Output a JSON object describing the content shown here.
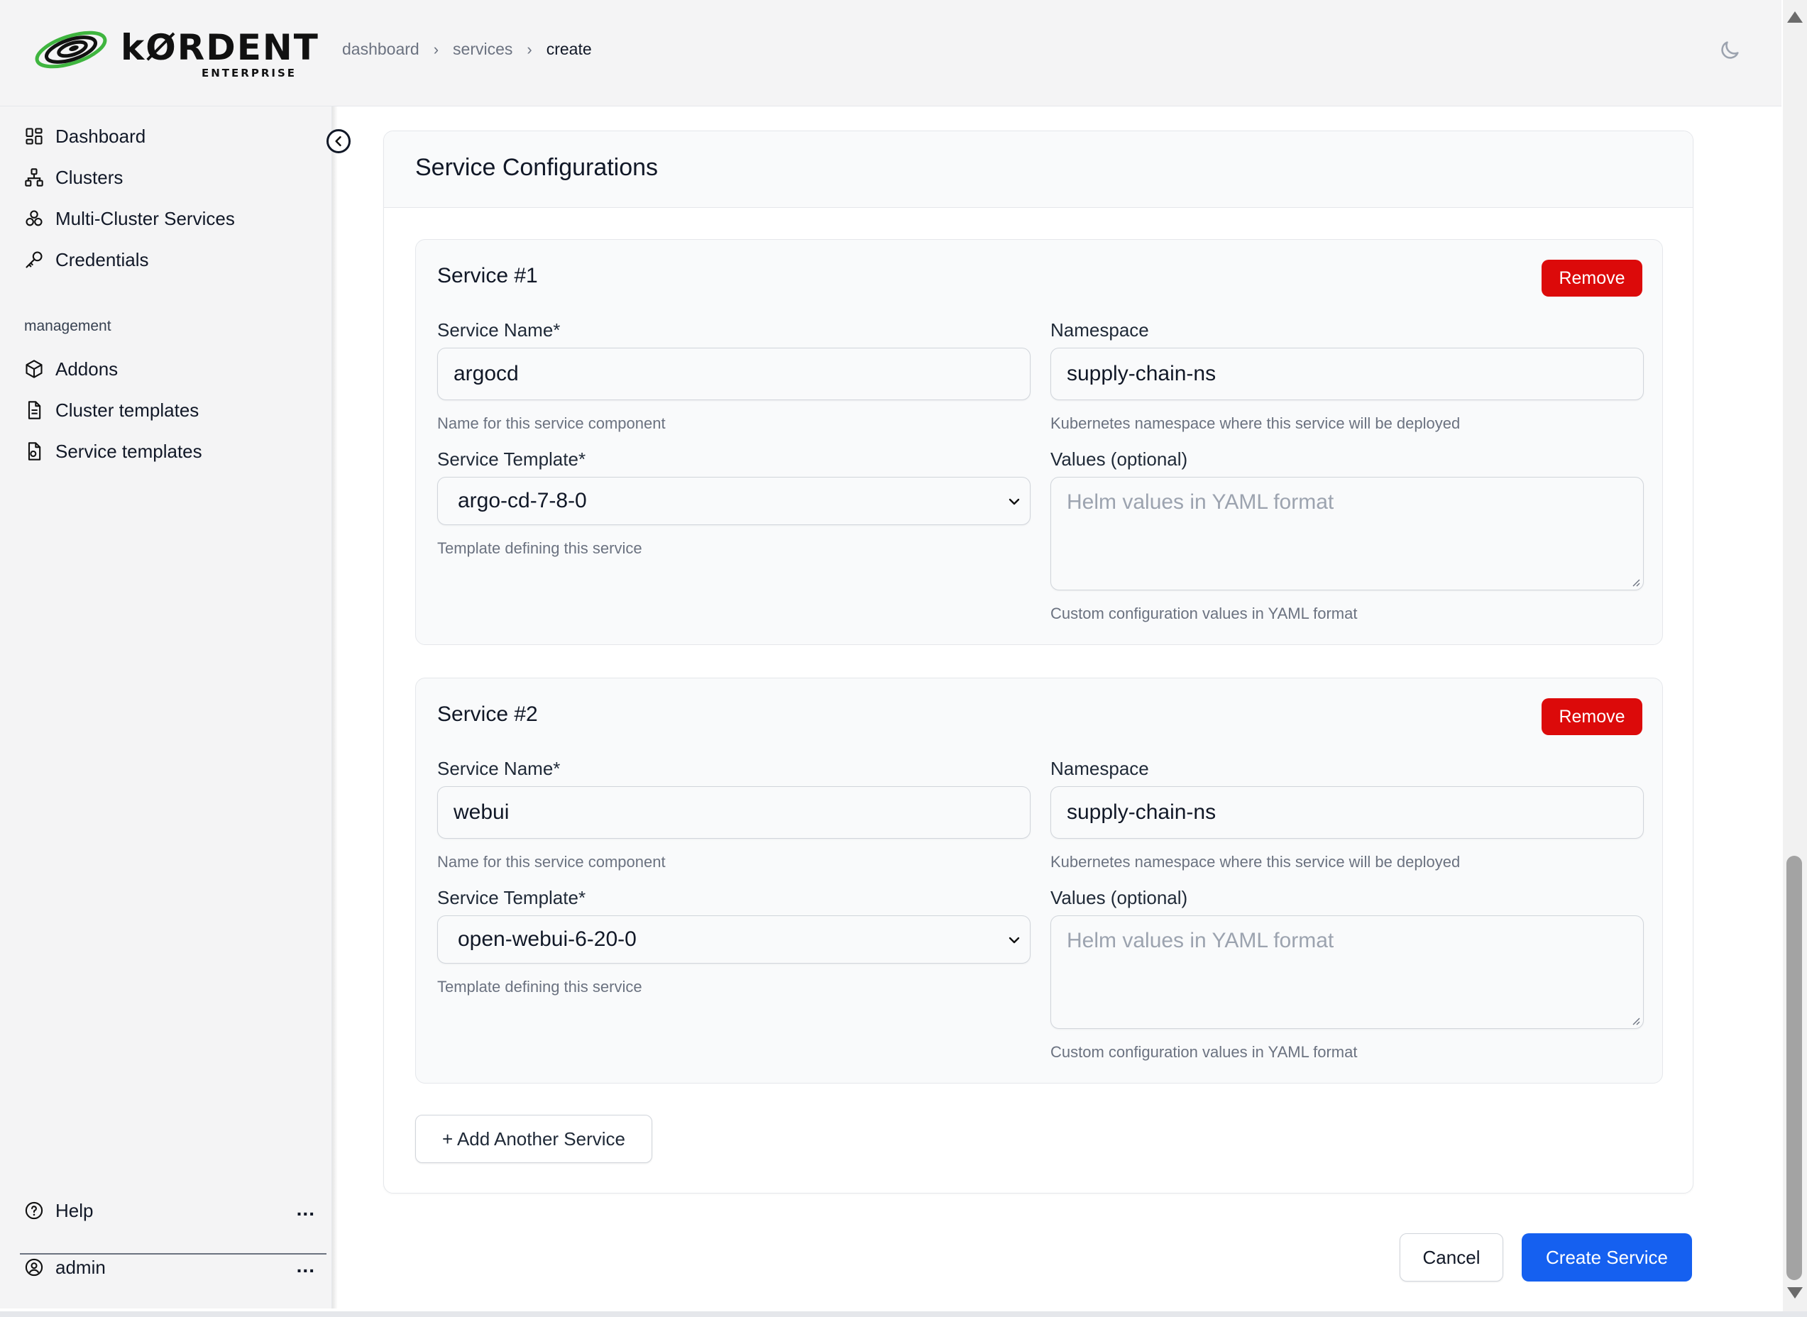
{
  "brand": {
    "name": "kØRDENT",
    "subtitle": "ENTERPRISE",
    "colors": {
      "logo_green": "#3fb53f",
      "logo_dark": "#111111"
    }
  },
  "breadcrumb": {
    "items": [
      "dashboard",
      "services",
      "create"
    ]
  },
  "header": {
    "theme_toggle_icon": "moon-icon"
  },
  "sidebar": {
    "items": [
      {
        "label": "Dashboard",
        "icon": "dashboard-grid-icon"
      },
      {
        "label": "Clusters",
        "icon": "clusters-icon"
      },
      {
        "label": "Multi-Cluster Services",
        "icon": "multi-cluster-icon"
      },
      {
        "label": "Credentials",
        "icon": "key-icon"
      }
    ],
    "group_label": "management",
    "management_items": [
      {
        "label": "Addons",
        "icon": "package-icon"
      },
      {
        "label": "Cluster templates",
        "icon": "file-icon"
      },
      {
        "label": "Service templates",
        "icon": "file-gear-icon"
      }
    ],
    "help_label": "Help",
    "user_label": "admin",
    "more_glyph": "..."
  },
  "main": {
    "title": "Service Configurations",
    "services": [
      {
        "title": "Service #1",
        "remove_label": "Remove",
        "name_label": "Service Name*",
        "name_value": "argocd",
        "name_help": "Name for this service component",
        "namespace_label": "Namespace",
        "namespace_value": "supply-chain-ns",
        "namespace_help": "Kubernetes namespace where this service will be deployed",
        "template_label": "Service Template*",
        "template_value": "argo-cd-7-8-0",
        "template_help": "Template defining this service",
        "values_label": "Values (optional)",
        "values_placeholder": "Helm values in YAML format",
        "values_help": "Custom configuration values in YAML format"
      },
      {
        "title": "Service #2",
        "remove_label": "Remove",
        "name_label": "Service Name*",
        "name_value": "webui",
        "name_help": "Name for this service component",
        "namespace_label": "Namespace",
        "namespace_value": "supply-chain-ns",
        "namespace_help": "Kubernetes namespace where this service will be deployed",
        "template_label": "Service Template*",
        "template_value": "open-webui-6-20-0",
        "template_help": "Template defining this service",
        "values_label": "Values (optional)",
        "values_placeholder": "Helm values in YAML format",
        "values_help": "Custom configuration values in YAML format"
      }
    ],
    "add_label": "+ Add Another Service"
  },
  "footer": {
    "cancel_label": "Cancel",
    "create_label": "Create Service"
  },
  "colors": {
    "remove": "#dc0a0a",
    "primary": "#1560f0",
    "sidebar_bg": "#f4f4f5"
  }
}
